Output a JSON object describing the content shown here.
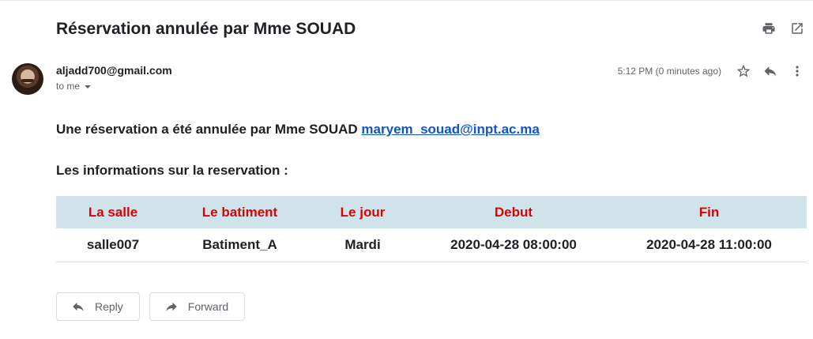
{
  "email": {
    "subject": "Réservation annulée par Mme SOUAD",
    "sender": "aljadd700@gmail.com",
    "recipient_label": "to me",
    "timestamp": "5:12 PM (0 minutes ago)",
    "body": {
      "line1_text": "Une réservation a été annulée par Mme SOUAD",
      "line1_link": "maryem_souad@inpt.ac.ma",
      "line2_text": "Les informations sur la reservation :"
    }
  },
  "table": {
    "headers": [
      "La salle",
      "Le batiment",
      "Le jour",
      "Debut",
      "Fin"
    ],
    "rows": [
      [
        "salle007",
        "Batiment_A",
        "Mardi",
        "2020-04-28 08:00:00",
        "2020-04-28 11:00:00"
      ]
    ]
  },
  "actions": {
    "reply_label": "Reply",
    "forward_label": "Forward"
  },
  "icons": {
    "top": [
      "print-icon",
      "open-in-new-window-icon"
    ],
    "message": [
      "star-icon",
      "reply-icon",
      "more-vert-icon"
    ]
  },
  "colors": {
    "header_bg": "#d0e3ea",
    "header_text": "#e00000",
    "link": "#1155cc"
  }
}
